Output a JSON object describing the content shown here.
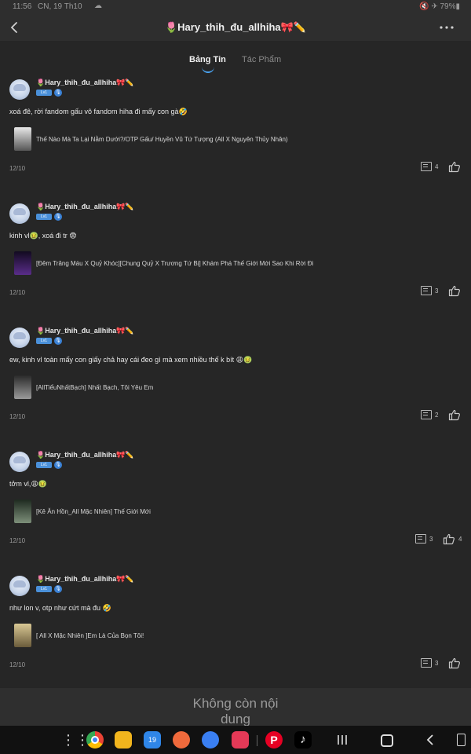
{
  "status_bar": {
    "time": "11:56",
    "date": "CN, 19 Th10",
    "right": "🔇 ✈ 79%▮"
  },
  "header": {
    "title": "🌷Hary_thih_đu_allhiha🎀✏️",
    "back_icon": "chevron-left-icon",
    "more_icon": "more-horizontal-icon"
  },
  "tabs": [
    {
      "label": "Bảng Tin",
      "active": true
    },
    {
      "label": "Tác Phẩm",
      "active": false
    }
  ],
  "user": {
    "name": "🌷Hary_thih_đu_allhiha🎀✏️",
    "level_badge": "Lv1",
    "verified_icon": "mic-icon"
  },
  "posts": [
    {
      "text": "xoá đê, rời fandom gấu vô fandom hiha đi mấy con gà🤣",
      "story_title": "Thế Nào Mà Ta Lại Nằm Dưới?/OTP Gấu/ Huyền Vũ Tứ Tượng (All X Nguyên Thủy Nhân)",
      "cover_color": "#c7c7c7",
      "date": "12/10",
      "comments": "4",
      "likes": ""
    },
    {
      "text": "kinh vl🤢, xoá đi tr 😨",
      "story_title": "[Đêm Trăng Máu X Quỷ Khóc][Chung Quỷ X Trương Tứ Bị] Khám Phá Thế Giới Mới Sao Khi Rời Đi",
      "cover_color": "#3a1f55",
      "date": "12/10",
      "comments": "3",
      "likes": ""
    },
    {
      "text": "ew, kinh vl toàn mấy con giấy chả hay cái đeo gì mà xem nhiều thế k bít 😩🤢",
      "story_title": "[AllTiểuNhấtBạch] Nhất Bạch, Tôi Yêu Em",
      "cover_color": "#8a8a8a",
      "date": "12/10",
      "comments": "2",
      "likes": ""
    },
    {
      "text": "tởm vl,😩🤢",
      "story_title": "[Kê Ăn Hồn_All Mặc Nhiên] Thế Giới Mới",
      "cover_color": "#4d5e4f",
      "date": "12/10",
      "comments": "3",
      "likes": "4"
    },
    {
      "text": "như lon v, otp như cứt mà đu 🤣",
      "story_title": "[ All X Mặc Nhiên ]Em Là Của Bọn Tôi!",
      "cover_color": "#b8a87a",
      "date": "12/10",
      "comments": "3",
      "likes": ""
    }
  ],
  "end_message": "Không còn nội dung",
  "taskbar": {
    "apps": [
      "apps-grid-icon",
      "chrome-icon",
      "files-icon",
      "calendar-icon",
      "contacts-icon",
      "messages-icon",
      "youtube-icon",
      "pinterest-icon",
      "tiktok-icon"
    ],
    "calendar_day": "19"
  }
}
